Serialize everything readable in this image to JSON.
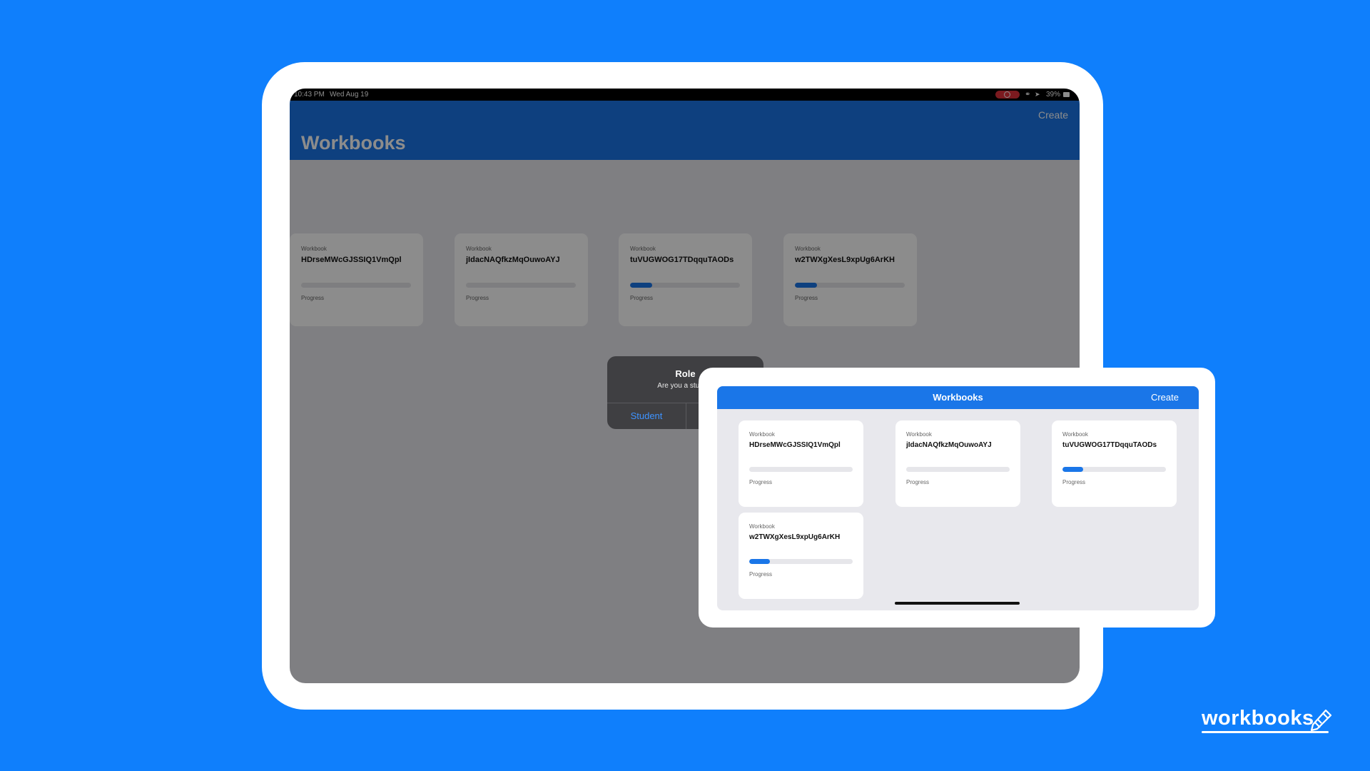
{
  "background_color": "#0f7ffc",
  "accent_color": "#1a76e8",
  "ipad": {
    "status_bar": {
      "time": "10:43 PM",
      "date": "Wed Aug 19",
      "battery": "39%"
    },
    "nav": {
      "title": "Workbooks",
      "create_label": "Create"
    },
    "cards": [
      {
        "label": "Workbook",
        "name": "HDrseMWcGJSSIQ1VmQpl",
        "progress": 0.0,
        "progress_label": "Progress"
      },
      {
        "label": "Workbook",
        "name": "jIdacNAQfkzMqOuwoAYJ",
        "progress": 0.0,
        "progress_label": "Progress"
      },
      {
        "label": "Workbook",
        "name": "tuVUGWOG17TDqquTAODs",
        "progress": 0.2,
        "progress_label": "Progress"
      },
      {
        "label": "Workbook",
        "name": "w2TWXgXesL9xpUg6ArKH",
        "progress": 0.2,
        "progress_label": "Progress"
      }
    ],
    "alert": {
      "title": "Role",
      "message": "Are you a student",
      "button_student": "Student"
    }
  },
  "inset": {
    "nav": {
      "title": "Workbooks",
      "create_label": "Create"
    },
    "cards": [
      {
        "label": "Workbook",
        "name": "HDrseMWcGJSSIQ1VmQpl",
        "progress": 0.0,
        "progress_label": "Progress"
      },
      {
        "label": "Workbook",
        "name": "jIdacNAQfkzMqOuwoAYJ",
        "progress": 0.0,
        "progress_label": "Progress"
      },
      {
        "label": "Workbook",
        "name": "tuVUGWOG17TDqquTAODs",
        "progress": 0.2,
        "progress_label": "Progress"
      },
      {
        "label": "Workbook",
        "name": "w2TWXgXesL9xpUg6ArKH",
        "progress": 0.2,
        "progress_label": "Progress"
      }
    ]
  },
  "brand": {
    "logo_text": "workbooks",
    "logo_icon": "pencil-icon"
  }
}
